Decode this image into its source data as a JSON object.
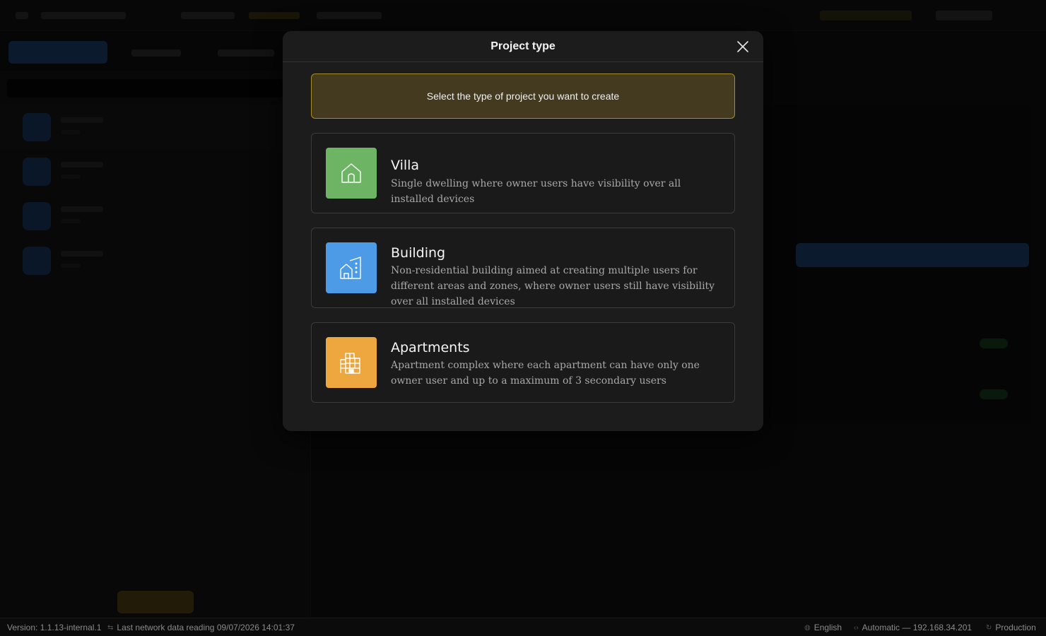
{
  "modal": {
    "title": "Project type",
    "info_banner": "Select the type of project you want to create",
    "types": [
      {
        "name": "Villa",
        "description": "Single dwelling where owner users have visibility over all installed devices",
        "icon": "house-icon",
        "color": "#6db464"
      },
      {
        "name": "Building",
        "description": "Non-residential building aimed at creating multiple users for different areas and zones, where owner users still have visibility over all installed devices",
        "icon": "building-icon",
        "color": "#4d9be6"
      },
      {
        "name": "Apartments",
        "description": "Apartment complex where each apartment can have only one owner user and up to a maximum of 3 secondary users",
        "icon": "apartments-icon",
        "color": "#eea63f"
      }
    ]
  },
  "statusbar": {
    "version": "Version: 1.1.13-internal.1",
    "last_reading": "Last network data reading 09/07/2026 14:01:37",
    "language": "English",
    "connection": "Automatic — 192.168.34.201",
    "environment": "Production"
  },
  "colors": {
    "banner_bg": "#433a1f",
    "banner_border": "#a88c2a",
    "modal_bg": "#1c1c1c"
  }
}
